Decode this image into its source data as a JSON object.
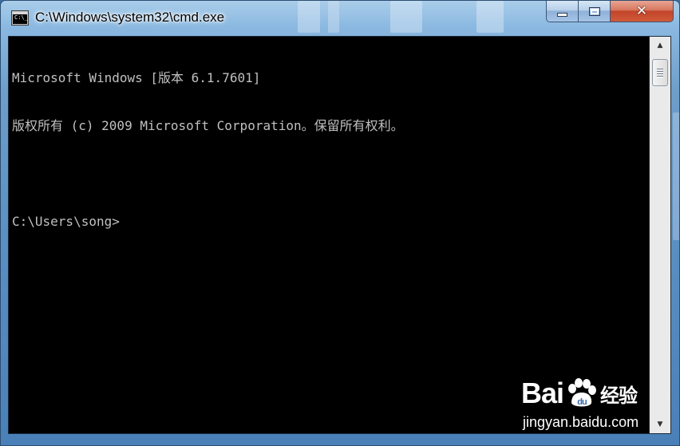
{
  "window": {
    "title": "C:\\Windows\\system32\\cmd.exe",
    "icon": "console-icon",
    "icon_glyph": "C:\\_",
    "controls": {
      "minimize_icon": "minimize-icon",
      "maximize_icon": "maximize-icon",
      "close_icon": "close-icon",
      "close_glyph": "✕"
    }
  },
  "console": {
    "lines": [
      "Microsoft Windows [版本 6.1.7601]",
      "版权所有 (c) 2009 Microsoft Corporation。保留所有权利。",
      "",
      "C:\\Users\\song>"
    ],
    "text_color": "#c0c0c0",
    "background_color": "#000000"
  },
  "scrollbar": {
    "up_glyph": "▲",
    "down_glyph": "▼"
  },
  "watermark": {
    "brand_prefix": "Bai",
    "brand_suffix": "经验",
    "url": "jingyan.baidu.com"
  }
}
